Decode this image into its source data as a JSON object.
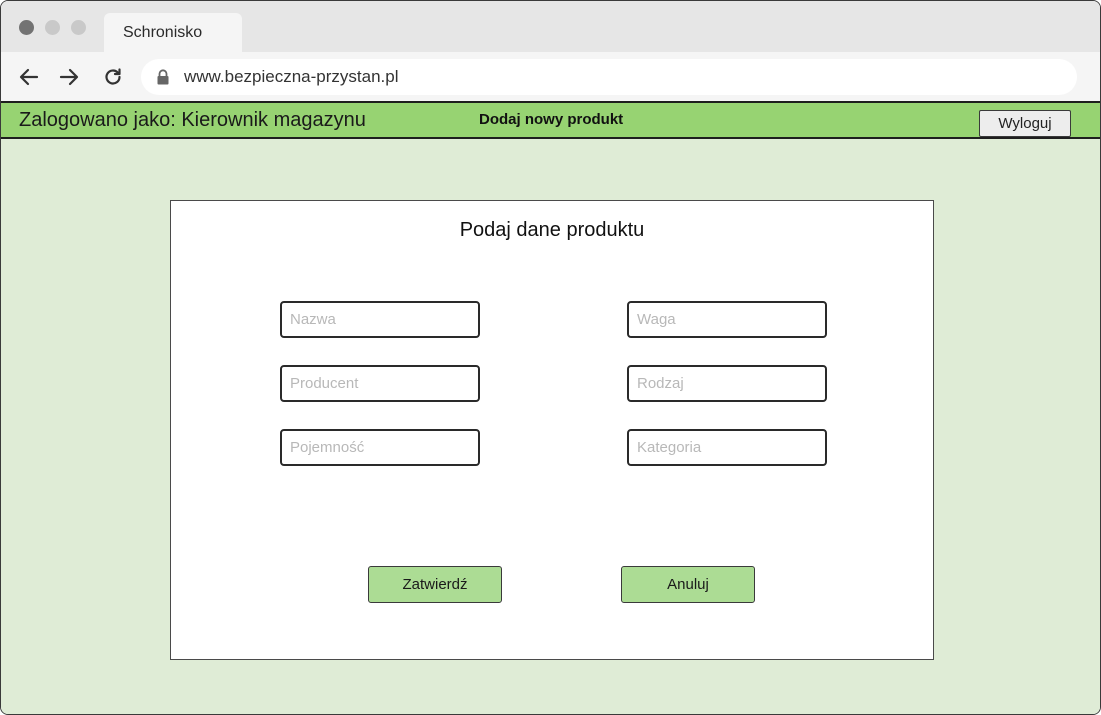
{
  "browser": {
    "tab_title": "Schronisko",
    "url": "www.bezpieczna-przystan.pl",
    "icons": [
      "back-icon",
      "forward-icon",
      "reload-icon",
      "lock-icon"
    ]
  },
  "header": {
    "logged_in_label": "Zalogowano jako: Kierownik magazynu",
    "page_title": "Dodaj nowy produkt",
    "logout_label": "Wyloguj"
  },
  "form": {
    "title": "Podaj dane produktu",
    "fields": {
      "nazwa": "Nazwa",
      "producent": "Producent",
      "pojemnosc": "Pojemność",
      "waga": "Waga",
      "rodzaj": "Rodzaj",
      "kategoria": "Kategoria"
    },
    "submit_label": "Zatwierdź",
    "cancel_label": "Anuluj"
  },
  "colors": {
    "header_green": "#97d372",
    "background_green": "#dfecd6",
    "button_green": "#acdc94"
  }
}
